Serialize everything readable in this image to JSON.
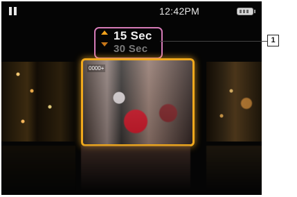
{
  "status": {
    "time": "12:42PM"
  },
  "interval": {
    "current": "15 Sec",
    "next": "30 Sec"
  },
  "callout": {
    "number": "1"
  },
  "thumbnail": {
    "center_label": "0000+"
  },
  "colors": {
    "highlight": "#f0a91d",
    "callout_border": "#d67bb8"
  }
}
